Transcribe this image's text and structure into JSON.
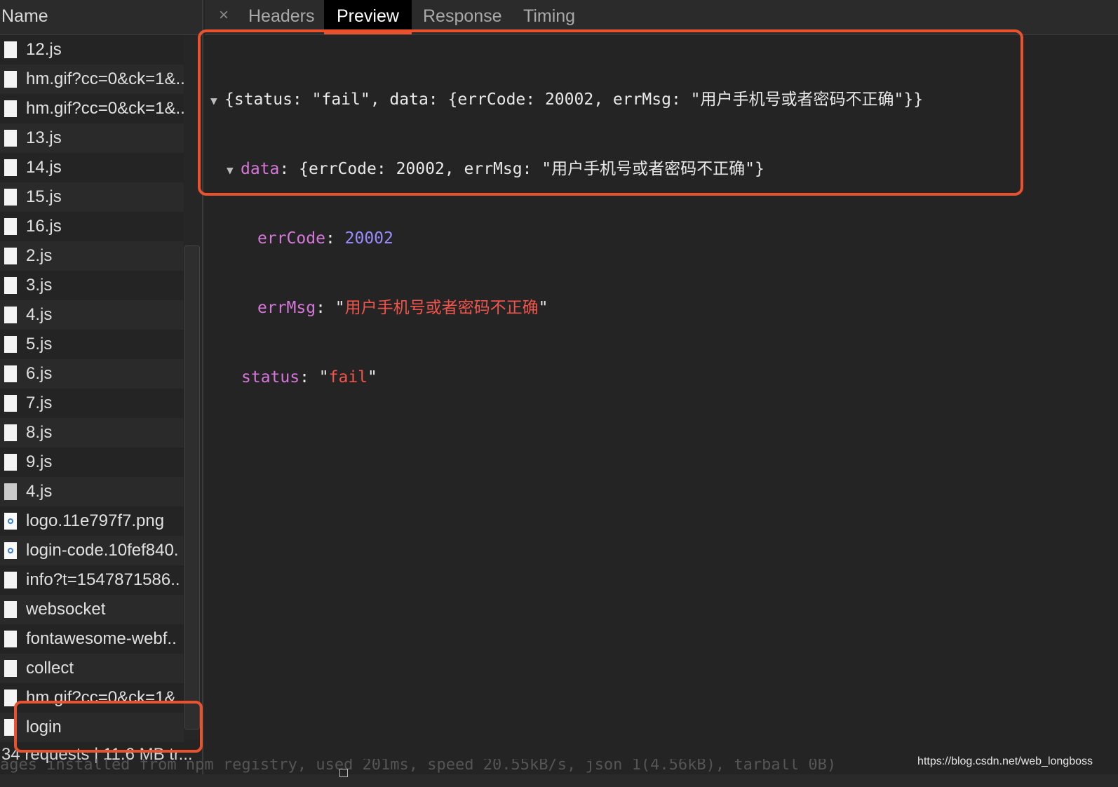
{
  "sidebar": {
    "header": "Name",
    "items": [
      {
        "label": "12.js",
        "icon": "document-icon"
      },
      {
        "label": "hm.gif?cc=0&ck=1&..",
        "icon": "document-icon"
      },
      {
        "label": "hm.gif?cc=0&ck=1&..",
        "icon": "document-icon"
      },
      {
        "label": "13.js",
        "icon": "document-icon"
      },
      {
        "label": "14.js",
        "icon": "document-icon"
      },
      {
        "label": "15.js",
        "icon": "document-icon"
      },
      {
        "label": "16.js",
        "icon": "document-icon"
      },
      {
        "label": "2.js",
        "icon": "document-icon"
      },
      {
        "label": "3.js",
        "icon": "document-icon"
      },
      {
        "label": "4.js",
        "icon": "document-icon"
      },
      {
        "label": "5.js",
        "icon": "document-icon"
      },
      {
        "label": "6.js",
        "icon": "document-icon"
      },
      {
        "label": "7.js",
        "icon": "document-icon"
      },
      {
        "label": "8.js",
        "icon": "document-icon"
      },
      {
        "label": "9.js",
        "icon": "document-icon"
      },
      {
        "label": "4.js",
        "icon": "script-icon"
      },
      {
        "label": "logo.11e797f7.png",
        "icon": "image-icon"
      },
      {
        "label": "login-code.10fef840.",
        "icon": "image-icon"
      },
      {
        "label": "info?t=1547871586..",
        "icon": "document-icon"
      },
      {
        "label": "websocket",
        "icon": "document-icon"
      },
      {
        "label": "fontawesome-webf..",
        "icon": "document-icon"
      },
      {
        "label": "collect",
        "icon": "document-icon"
      },
      {
        "label": "hm.gif?cc=0&ck=1&..",
        "icon": "document-icon"
      },
      {
        "label": "login",
        "icon": "document-icon"
      }
    ],
    "status": "34 requests | 11.6 MB tr..."
  },
  "tabs": {
    "close_symbol": "×",
    "items": [
      {
        "label": "Headers",
        "active": false
      },
      {
        "label": "Preview",
        "active": true
      },
      {
        "label": "Response",
        "active": false
      },
      {
        "label": "Timing",
        "active": false
      }
    ]
  },
  "preview": {
    "root_summary": "{status: \"fail\", data: {errCode: 20002, errMsg: \"用户手机号或者密码不正确\"}}",
    "data_key": "data",
    "data_summary": "{errCode: 20002, errMsg: \"用户手机号或者密码不正确\"}",
    "errCode_key": "errCode",
    "errCode_value": "20002",
    "errMsg_key": "errMsg",
    "errMsg_value": "用户手机号或者密码不正确",
    "status_key": "status",
    "status_value": "fail"
  },
  "console_ghost": "ages installed from npm registry, used 201ms, speed 20.55kB/s, json 1(4.56kB), tarball 0B)",
  "watermark": "https://blog.csdn.net/web_longboss",
  "colors": {
    "accent": "#e9522e",
    "key": "#d678d9",
    "number": "#9a8cff",
    "string": "#f1544b",
    "background": "#242424"
  }
}
